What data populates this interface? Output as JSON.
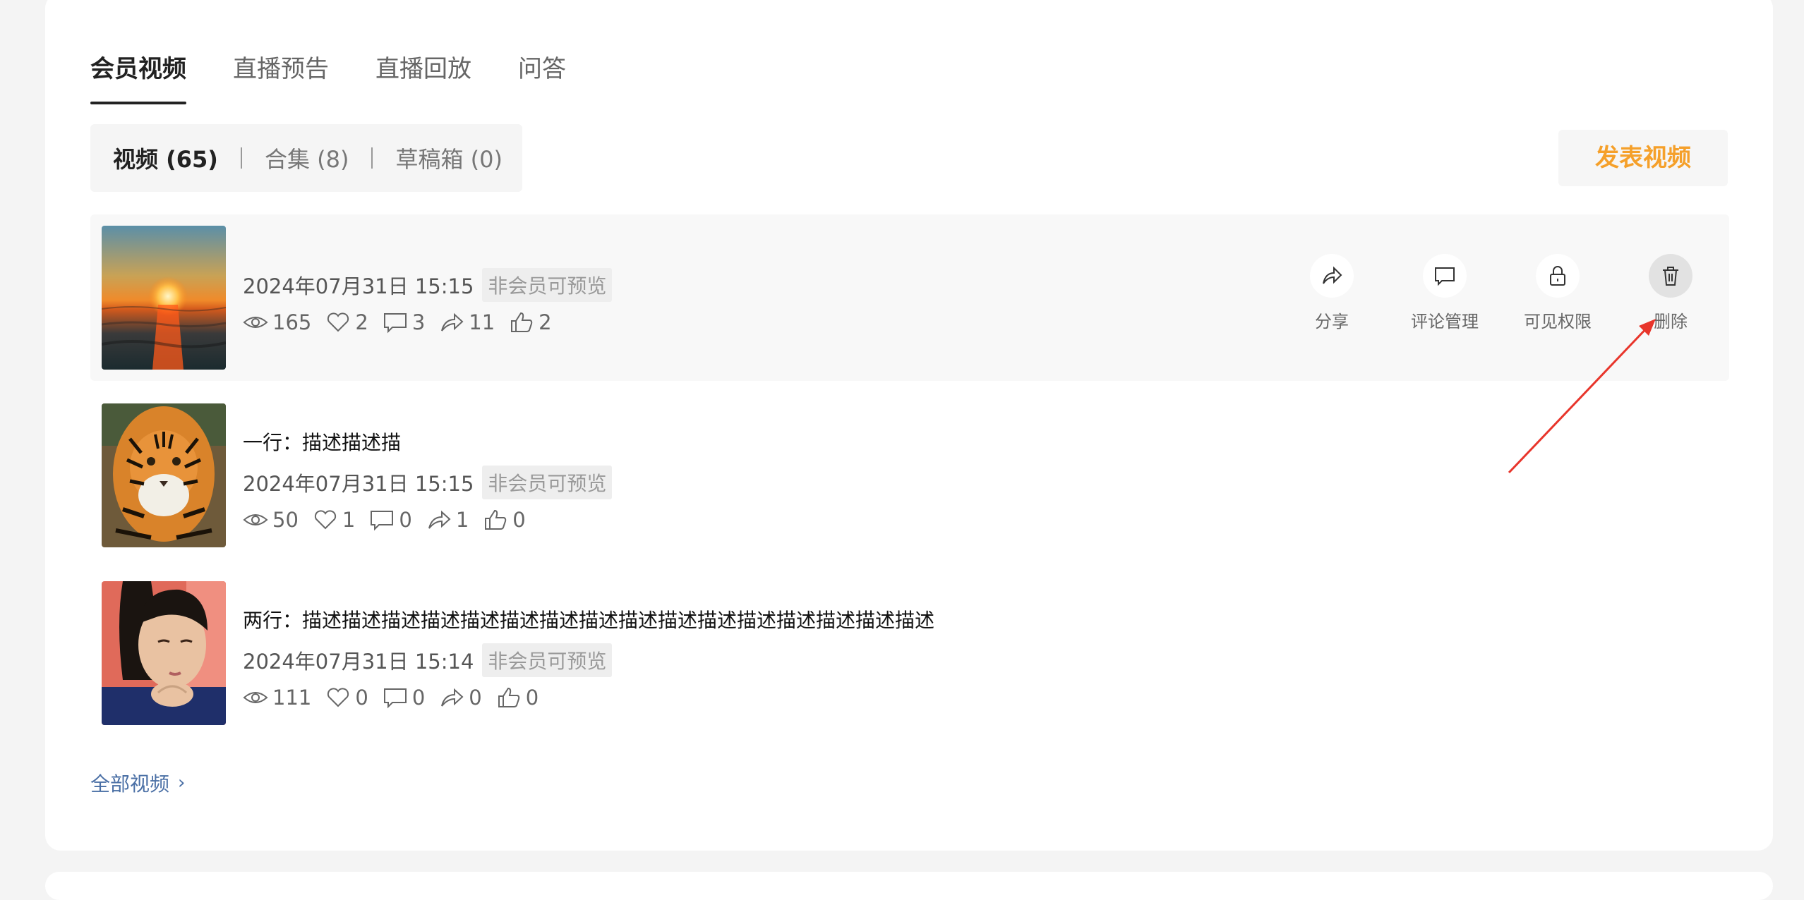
{
  "tabs": [
    {
      "label": "会员视频",
      "active": true
    },
    {
      "label": "直播预告",
      "active": false
    },
    {
      "label": "直播回放",
      "active": false
    },
    {
      "label": "问答",
      "active": false
    }
  ],
  "subtabs": {
    "videos": "视频 (65)",
    "collections": "合集 (8)",
    "drafts": "草稿箱 (0)"
  },
  "publish_button": "发表视频",
  "videos": [
    {
      "title": "",
      "date": "2024年07月31日 15:15",
      "badge": "非会员可预览",
      "thumb": "sunset-sea",
      "views": "165",
      "likes": "2",
      "comments": "3",
      "shares": "11",
      "thumbs_up": "2"
    },
    {
      "title": "一行：描述描述描",
      "date": "2024年07月31日 15:15",
      "badge": "非会员可预览",
      "thumb": "tiger",
      "views": "50",
      "likes": "1",
      "comments": "0",
      "shares": "1",
      "thumbs_up": "0"
    },
    {
      "title": "两行：描述描述描述描述描述描述描述描述描述描述描述描述描述描述描述描述",
      "date": "2024年07月31日 15:14",
      "badge": "非会员可预览",
      "thumb": "woman-portrait",
      "views": "111",
      "likes": "0",
      "comments": "0",
      "shares": "0",
      "thumbs_up": "0"
    }
  ],
  "actions": {
    "share": "分享",
    "comment_manage": "评论管理",
    "visibility": "可见权限",
    "delete": "删除"
  },
  "all_videos_link": "全部视频",
  "colors": {
    "accent_orange": "#f5a02a",
    "link_blue": "#4a6fa5",
    "annotation_red": "#e8352b"
  }
}
